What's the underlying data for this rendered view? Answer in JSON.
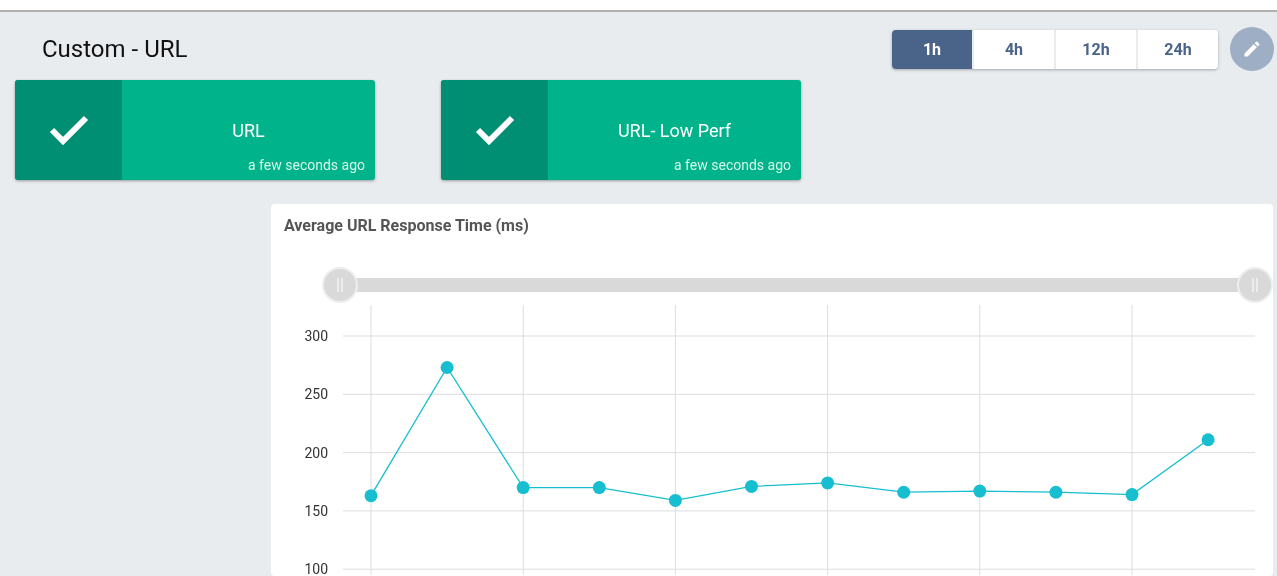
{
  "page": {
    "title": "Custom - URL"
  },
  "time_ranges": [
    {
      "label": "1h",
      "selected": true
    },
    {
      "label": "4h",
      "selected": false
    },
    {
      "label": "12h",
      "selected": false
    },
    {
      "label": "24h",
      "selected": false
    }
  ],
  "monitors": [
    {
      "name": "URL",
      "healthy": true,
      "updated": "a few seconds ago"
    },
    {
      "name": "URL- Low Perf",
      "healthy": true,
      "updated": "a few seconds ago"
    }
  ],
  "chart": {
    "chart_data": {
      "type": "line",
      "title": "Average URL Response Time (ms)",
      "ylim": [
        100,
        300
      ],
      "yticks": [
        100,
        150,
        200,
        250,
        300
      ],
      "grid": true,
      "series": [
        {
          "color": "#17becf",
          "marker": "circle",
          "values": [
            163,
            273,
            170,
            170,
            159,
            171,
            174,
            166,
            167,
            166,
            164,
            211
          ]
        }
      ]
    }
  }
}
